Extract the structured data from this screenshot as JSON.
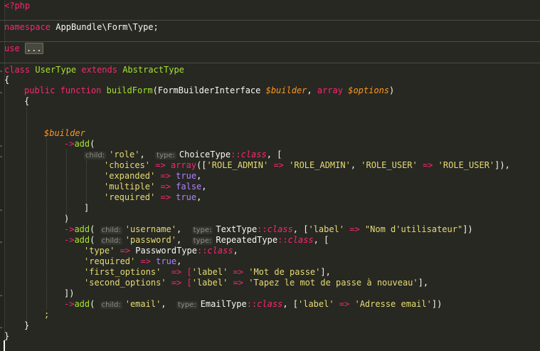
{
  "editor": {
    "l01": "<?php",
    "l02_kw": "namespace",
    "l02_ns": "AppBundle\\Form\\Type;",
    "l03_kw": "use",
    "l03_fold": "...",
    "l04_kw1": "class",
    "l04_name": "UserType",
    "l04_kw2": "extends",
    "l04_base": "AbstractType",
    "l05": "{",
    "l06_kw1": "public",
    "l06_kw2": "function",
    "l06_fn": "buildForm",
    "l06_p1": "(FormBuilderInterface ",
    "l06_v1": "$builder",
    "l06_p2": ", ",
    "l06_kw3": "array",
    "l06_p3": " ",
    "l06_v2": "$options",
    "l06_p4": ")",
    "l07": "{",
    "l08_var": "$builder",
    "l09_arrow": "->",
    "l09_fn": "add",
    "l09_p": "(",
    "hint_child": "child:",
    "hint_type": "type:",
    "l10_s1": "'role'",
    "l10_comma": ",",
    "l10_cls": "ChoiceType",
    "l10_dc": "::",
    "l10_class": "class",
    "l10_rest": ", [",
    "l11_s1": "'choices'",
    "l11_op": " => ",
    "l11_arr": "array",
    "l11_p1": "([",
    "l11_s2": "'ROLE_ADMIN'",
    "l11_op2": " => ",
    "l11_s3": "'ROLE_ADMIN'",
    "l11_c": ", ",
    "l11_s4": "'ROLE_USER'",
    "l11_op3": " => ",
    "l11_s5": "'ROLE_USER'",
    "l11_end": "]),",
    "l12_s": "'expanded'",
    "l12_op": " => ",
    "l12_v": "true",
    "l12_e": ",",
    "l13_s": "'multiple'",
    "l13_op": " => ",
    "l13_v": "false",
    "l13_e": ",",
    "l14_s": "'required'",
    "l14_op": " => ",
    "l14_v": "true",
    "l14_e": ",",
    "l15": "]",
    "l16": ")",
    "l17_arrow": "->",
    "l17_fn": "add",
    "l17_p": "(",
    "l17_s1": "'username'",
    "l17_c": ",",
    "l17_cls": "TextType",
    "l17_dc": "::",
    "l17_class": "class",
    "l17_p2": ", [",
    "l17_s2": "'label'",
    "l17_op": " => ",
    "l17_s3": "\"Nom d'utilisateur\"",
    "l17_end": "])",
    "l18_arrow": "->",
    "l18_fn": "add",
    "l18_p": "(",
    "l18_s1": "'password'",
    "l18_c": ",",
    "l18_cls": "RepeatedType",
    "l18_dc": "::",
    "l18_class": "class",
    "l18_end": ", [",
    "l19_s": "'type'",
    "l19_op": " => ",
    "l19_cls": "PasswordType",
    "l19_dc": "::",
    "l19_class": "class",
    "l19_e": ",",
    "l20_s": "'required'",
    "l20_op": " => ",
    "l20_v": "true",
    "l20_e": ",",
    "l21_s": "'first_options'",
    "l21_op": "  => [",
    "l21_s2": "'label'",
    "l21_op2": " => ",
    "l21_s3": "'Mot de passe'",
    "l21_e": "],",
    "l22_s": "'second_options'",
    "l22_op": " => [",
    "l22_s2": "'label'",
    "l22_op2": " => ",
    "l22_s3": "'Tapez le mot de passe à nouveau'",
    "l22_e": "],",
    "l23": "])",
    "l24_arrow": "->",
    "l24_fn": "add",
    "l24_p": "(",
    "l24_s1": "'email'",
    "l24_c": ",",
    "l24_cls": "EmailType",
    "l24_dc": "::",
    "l24_class": "class",
    "l24_p2": ", [",
    "l24_s2": "'label'",
    "l24_op": " => ",
    "l24_s3": "'Adresse email'",
    "l24_end": "])",
    "l25": ";",
    "l26": "}",
    "l27": "}"
  },
  "colors": {
    "background": "#272822",
    "keyword": "#f92672",
    "function": "#a6e22e",
    "variable": "#fd971f",
    "string": "#e6db74",
    "constant": "#ae81ff"
  }
}
